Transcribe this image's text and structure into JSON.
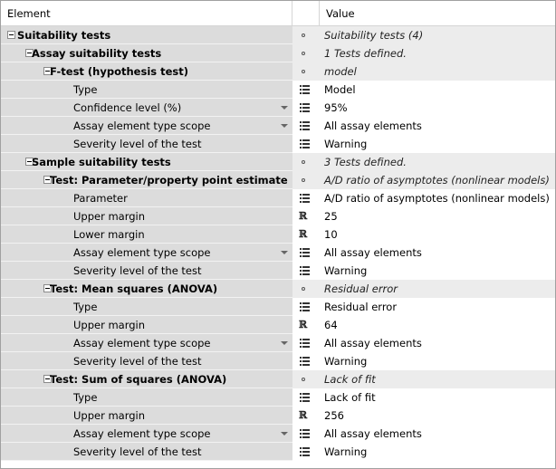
{
  "header": {
    "element": "Element",
    "value": "Value"
  },
  "rows": [
    {
      "label": "Suitability tests",
      "value": "Suitability tests (4)",
      "level": 0,
      "group": true,
      "icon": "dot-icon"
    },
    {
      "label": "Assay suitability tests",
      "value": "1 Tests defined.",
      "level": 1,
      "group": true,
      "icon": "dot-icon"
    },
    {
      "label": "F-test (hypothesis test)",
      "value": "model",
      "level": 2,
      "group": true,
      "icon": "dot-icon"
    },
    {
      "label": "Type",
      "value": "Model",
      "level": 3,
      "icon": "list-icon"
    },
    {
      "label": "Confidence level (%)",
      "value": "95%",
      "level": 3,
      "icon": "list-icon",
      "dropdown": true
    },
    {
      "label": "Assay element type scope",
      "value": "All assay elements",
      "level": 3,
      "icon": "list-icon",
      "dropdown": true
    },
    {
      "label": "Severity level of the test",
      "value": "Warning",
      "level": 3,
      "icon": "list-icon"
    },
    {
      "label": "Sample suitability tests",
      "value": "3 Tests defined.",
      "level": 1,
      "group": true,
      "icon": "dot-icon"
    },
    {
      "label": "Test: Parameter/property point estimate",
      "value": "A/D ratio of asymptotes (nonlinear models)",
      "level": 2,
      "group": true,
      "icon": "dot-icon"
    },
    {
      "label": "Parameter",
      "value": "A/D ratio of asymptotes (nonlinear models)",
      "level": 3,
      "icon": "list-icon"
    },
    {
      "label": "Upper margin",
      "value": "25",
      "level": 3,
      "icon": "real-number-icon"
    },
    {
      "label": "Lower margin",
      "value": "10",
      "level": 3,
      "icon": "real-number-icon"
    },
    {
      "label": "Assay element type scope",
      "value": "All assay elements",
      "level": 3,
      "icon": "list-icon",
      "dropdown": true
    },
    {
      "label": "Severity level of the test",
      "value": "Warning",
      "level": 3,
      "icon": "list-icon"
    },
    {
      "label": "Test: Mean squares (ANOVA)",
      "value": "Residual error",
      "level": 2,
      "group": true,
      "icon": "dot-icon"
    },
    {
      "label": "Type",
      "value": "Residual error",
      "level": 3,
      "icon": "list-icon"
    },
    {
      "label": "Upper margin",
      "value": "64",
      "level": 3,
      "icon": "real-number-icon"
    },
    {
      "label": "Assay element type scope",
      "value": "All assay elements",
      "level": 3,
      "icon": "list-icon",
      "dropdown": true
    },
    {
      "label": "Severity level of the test",
      "value": "Warning",
      "level": 3,
      "icon": "list-icon"
    },
    {
      "label": "Test: Sum of squares (ANOVA)",
      "value": "Lack of fit",
      "level": 2,
      "group": true,
      "icon": "dot-icon"
    },
    {
      "label": "Type",
      "value": "Lack of fit",
      "level": 3,
      "icon": "list-icon"
    },
    {
      "label": "Upper margin",
      "value": "256",
      "level": 3,
      "icon": "real-number-icon"
    },
    {
      "label": "Assay element type scope",
      "value": "All assay elements",
      "level": 3,
      "icon": "list-icon",
      "dropdown": true
    },
    {
      "label": "Severity level of the test",
      "value": "Warning",
      "level": 3,
      "icon": "list-icon"
    }
  ]
}
